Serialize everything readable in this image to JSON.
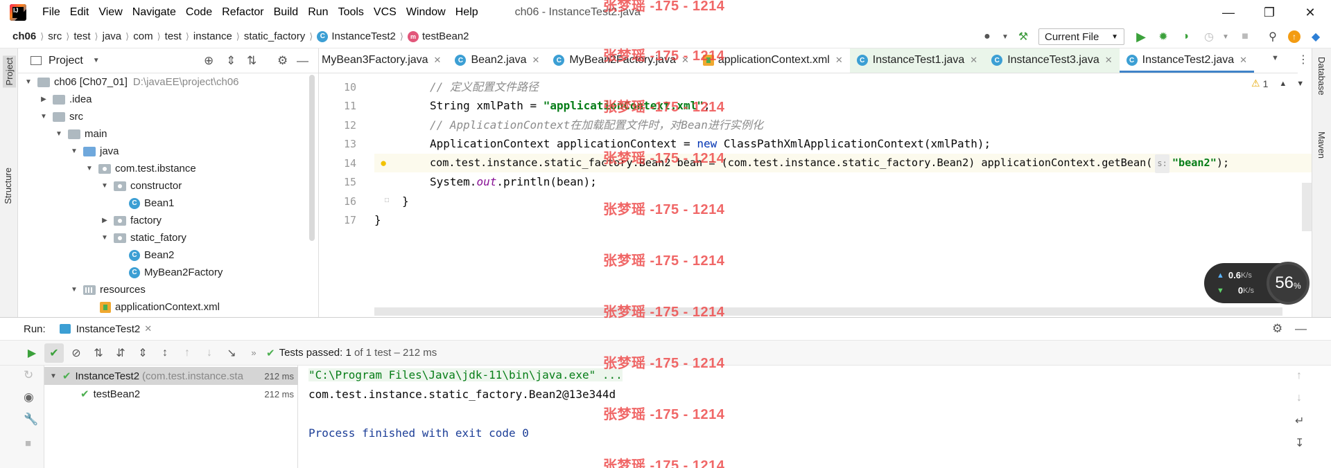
{
  "window": {
    "title": "ch06 - InstanceTest2.java",
    "menu": [
      "File",
      "Edit",
      "View",
      "Navigate",
      "Code",
      "Refactor",
      "Build",
      "Run",
      "Tools",
      "VCS",
      "Window",
      "Help"
    ]
  },
  "navbar": {
    "breadcrumb": [
      "ch06",
      "src",
      "test",
      "java",
      "com",
      "test",
      "instance",
      "static_factory",
      "InstanceTest2",
      "testBean2"
    ],
    "run_config": "Current File"
  },
  "left_strip": {
    "tabs": [
      "Project",
      "Structure"
    ]
  },
  "right_strip": {
    "tabs": [
      "Database",
      "Maven"
    ]
  },
  "project": {
    "header": "Project",
    "tree": [
      {
        "label": "ch06 [Ch07_01]",
        "hint": "D:\\javaEE\\project\\ch06",
        "depth": 0,
        "kind": "module",
        "expanded": true
      },
      {
        "label": ".idea",
        "depth": 1,
        "kind": "folder",
        "expanded": false
      },
      {
        "label": "src",
        "depth": 1,
        "kind": "folder",
        "expanded": true
      },
      {
        "label": "main",
        "depth": 2,
        "kind": "folder",
        "expanded": true
      },
      {
        "label": "java",
        "depth": 3,
        "kind": "src-folder",
        "expanded": true
      },
      {
        "label": "com.test.ibstance",
        "depth": 4,
        "kind": "package",
        "expanded": true
      },
      {
        "label": "constructor",
        "depth": 5,
        "kind": "package",
        "expanded": true
      },
      {
        "label": "Bean1",
        "depth": 6,
        "kind": "class"
      },
      {
        "label": "factory",
        "depth": 5,
        "kind": "package",
        "expanded": false
      },
      {
        "label": "static_fatory",
        "depth": 5,
        "kind": "package",
        "expanded": true
      },
      {
        "label": "Bean2",
        "depth": 6,
        "kind": "class"
      },
      {
        "label": "MyBean2Factory",
        "depth": 6,
        "kind": "class"
      },
      {
        "label": "resources",
        "depth": 3,
        "kind": "resources",
        "expanded": true
      },
      {
        "label": "applicationContext.xml",
        "depth": 4,
        "kind": "xml"
      }
    ]
  },
  "editor": {
    "tabs": [
      {
        "label": "MyBean3Factory.java",
        "icon": "none",
        "active": false,
        "green": false
      },
      {
        "label": "Bean2.java",
        "icon": "class",
        "active": false,
        "green": false
      },
      {
        "label": "MyBean2Factory.java",
        "icon": "class",
        "active": false,
        "green": false
      },
      {
        "label": "applicationContext.xml",
        "icon": "xml",
        "active": false,
        "green": false
      },
      {
        "label": "InstanceTest1.java",
        "icon": "class",
        "active": false,
        "green": true
      },
      {
        "label": "InstanceTest3.java",
        "icon": "class",
        "active": false,
        "green": true
      },
      {
        "label": "InstanceTest2.java",
        "icon": "class",
        "active": true,
        "green": false
      }
    ],
    "warning_count": "1",
    "line_numbers": [
      "10",
      "11",
      "12",
      "13",
      "14",
      "15",
      "16",
      "17"
    ],
    "lines": {
      "l10": "// 定义配置文件路径",
      "l11_a": "String xmlPath = ",
      "l11_str": "\"applicationContext.xml\"",
      "l11_b": ";",
      "l12": "// ApplicationContext在加载配置文件时，对Bean进行实例化",
      "l13_a": "ApplicationContext applicationContext = ",
      "l13_kw": "new",
      "l13_b": " ClassPathXmlApplicationContext(xmlPath);",
      "l14_a": "com.test.instance.static_factory.Bean2 bean = (com.test.instance.static_factory.Bean2) applicationContext.getBean(",
      "l14_hint": "s:",
      "l14_str": "\"bean2\"",
      "l14_b": ");",
      "l15_a": "System.",
      "l15_out": "out",
      "l15_b": ".println(bean);",
      "l16": "}",
      "l17": "}"
    }
  },
  "net_widget": {
    "up": "0.6",
    "up_unit": "K/s",
    "down": "0",
    "down_unit": "K/s",
    "percent": "56",
    "percent_unit": "%"
  },
  "run": {
    "label": "Run:",
    "tab": "InstanceTest2",
    "status_prefix": "Tests passed:",
    "status_count": "1",
    "status_suffix": "of 1 test – 212 ms",
    "tests": [
      {
        "name": "InstanceTest2",
        "detail": "(com.test.instance.sta",
        "time": "212 ms"
      },
      {
        "name": "testBean2",
        "detail": "",
        "time": "212 ms"
      }
    ],
    "console": [
      "\"C:\\Program Files\\Java\\jdk-11\\bin\\java.exe\" ...",
      "com.test.instance.static_factory.Bean2@13e344d",
      "",
      "Process finished with exit code 0"
    ]
  },
  "watermark": "张梦瑶 -175 - 1214",
  "colors": {
    "accent": "#4083c9",
    "pass": "#4caf50",
    "string": "#067d17",
    "keyword": "#0033b3",
    "watermark": "#ed4646"
  }
}
